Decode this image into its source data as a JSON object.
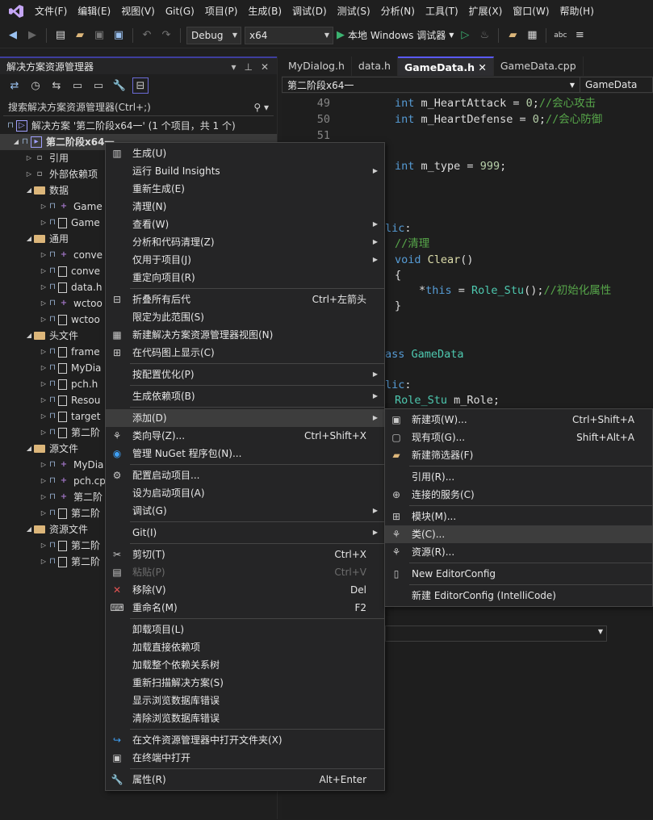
{
  "menubar": {
    "items": [
      "文件(F)",
      "编辑(E)",
      "视图(V)",
      "Git(G)",
      "项目(P)",
      "生成(B)",
      "调试(D)",
      "测试(S)",
      "分析(N)",
      "工具(T)",
      "扩展(X)",
      "窗口(W)",
      "帮助(H)"
    ]
  },
  "toolbar": {
    "config": "Debug",
    "platform": "x64",
    "run_label": "本地 Windows 调试器"
  },
  "solution_explorer": {
    "title": "解决方案资源管理器",
    "search_placeholder": "搜索解决方案资源管理器(Ctrl+;)",
    "solution_label": "解决方案 '第二阶段x64一' (1 个项目，共 1 个)",
    "project_label": "第二阶段x64一",
    "items": [
      {
        "label": "引用",
        "kind": "ref",
        "depth": 1
      },
      {
        "label": "外部依赖项",
        "kind": "ref",
        "depth": 1
      },
      {
        "label": "数据",
        "kind": "folder",
        "depth": 1
      },
      {
        "label": "Game",
        "kind": "cpp",
        "depth": 2
      },
      {
        "label": "Game",
        "kind": "file",
        "depth": 2
      },
      {
        "label": "通用",
        "kind": "folder",
        "depth": 1
      },
      {
        "label": "conve",
        "kind": "cpp",
        "depth": 2
      },
      {
        "label": "conve",
        "kind": "file",
        "depth": 2
      },
      {
        "label": "data.h",
        "kind": "file",
        "depth": 2
      },
      {
        "label": "wctoo",
        "kind": "cpp",
        "depth": 2
      },
      {
        "label": "wctoo",
        "kind": "file",
        "depth": 2
      },
      {
        "label": "头文件",
        "kind": "folder",
        "depth": 1
      },
      {
        "label": "frame",
        "kind": "file",
        "depth": 2
      },
      {
        "label": "MyDia",
        "kind": "file",
        "depth": 2
      },
      {
        "label": "pch.h",
        "kind": "file",
        "depth": 2
      },
      {
        "label": "Resou",
        "kind": "file",
        "depth": 2
      },
      {
        "label": "target",
        "kind": "file",
        "depth": 2
      },
      {
        "label": "第二阶",
        "kind": "file",
        "depth": 2
      },
      {
        "label": "源文件",
        "kind": "folder",
        "depth": 1
      },
      {
        "label": "MyDia",
        "kind": "cpp",
        "depth": 2
      },
      {
        "label": "pch.cp",
        "kind": "cpp",
        "depth": 2
      },
      {
        "label": "第二阶",
        "kind": "cpp",
        "depth": 2
      },
      {
        "label": "第二阶",
        "kind": "file",
        "depth": 2
      },
      {
        "label": "资源文件",
        "kind": "folder",
        "depth": 1
      },
      {
        "label": "第二阶",
        "kind": "file",
        "depth": 2
      },
      {
        "label": "第二阶",
        "kind": "file",
        "depth": 2
      }
    ]
  },
  "editor": {
    "tabs": [
      "MyDialog.h",
      "data.h",
      "GameData.h",
      "GameData.cpp"
    ],
    "active_tab": "GameData.h",
    "nav_scope": "第二阶段x64一",
    "nav_symbol": "GameData",
    "line_numbers": [
      "49",
      "50",
      "51"
    ]
  },
  "context_menu": {
    "items": [
      {
        "label": "生成(U)",
        "icon": "build-icon"
      },
      {
        "label": "运行 Build Insights",
        "submenu": true
      },
      {
        "label": "重新生成(E)"
      },
      {
        "label": "清理(N)"
      },
      {
        "label": "查看(W)",
        "submenu": true
      },
      {
        "label": "分析和代码清理(Z)",
        "submenu": true
      },
      {
        "label": "仅用于项目(J)",
        "submenu": true
      },
      {
        "label": "重定向项目(R)"
      },
      {
        "sep": true
      },
      {
        "label": "折叠所有后代",
        "shortcut": "Ctrl+左箭头",
        "icon": "collapse-icon"
      },
      {
        "label": "限定为此范围(S)"
      },
      {
        "label": "新建解决方案资源管理器视图(N)",
        "icon": "new-view-icon"
      },
      {
        "label": "在代码图上显示(C)",
        "icon": "code-map-icon"
      },
      {
        "sep": true
      },
      {
        "label": "按配置优化(P)",
        "submenu": true
      },
      {
        "sep": true
      },
      {
        "label": "生成依赖项(B)",
        "submenu": true
      },
      {
        "sep": true
      },
      {
        "label": "添加(D)",
        "submenu": true,
        "highlighted": true
      },
      {
        "label": "类向导(Z)...",
        "shortcut": "Ctrl+Shift+X",
        "icon": "class-wizard-icon"
      },
      {
        "label": "管理 NuGet 程序包(N)...",
        "icon": "nuget-icon"
      },
      {
        "sep": true
      },
      {
        "label": "配置启动项目...",
        "icon": "gear-icon"
      },
      {
        "label": "设为启动项目(A)"
      },
      {
        "label": "调试(G)",
        "submenu": true
      },
      {
        "sep": true
      },
      {
        "label": "Git(I)",
        "submenu": true
      },
      {
        "sep": true
      },
      {
        "label": "剪切(T)",
        "shortcut": "Ctrl+X",
        "icon": "cut-icon"
      },
      {
        "label": "粘贴(P)",
        "shortcut": "Ctrl+V",
        "icon": "paste-icon",
        "disabled": true
      },
      {
        "label": "移除(V)",
        "shortcut": "Del",
        "icon": "remove-icon"
      },
      {
        "label": "重命名(M)",
        "shortcut": "F2",
        "icon": "rename-icon"
      },
      {
        "sep": true
      },
      {
        "label": "卸载项目(L)"
      },
      {
        "label": "加载直接依赖项"
      },
      {
        "label": "加载整个依赖关系树"
      },
      {
        "label": "重新扫描解决方案(S)"
      },
      {
        "label": "显示浏览数据库错误"
      },
      {
        "label": "清除浏览数据库错误"
      },
      {
        "sep": true
      },
      {
        "label": "在文件资源管理器中打开文件夹(X)",
        "icon": "open-folder-icon"
      },
      {
        "label": "在终端中打开",
        "icon": "terminal-icon"
      },
      {
        "sep": true
      },
      {
        "label": "属性(R)",
        "shortcut": "Alt+Enter",
        "icon": "wrench-icon"
      }
    ]
  },
  "add_submenu": {
    "items": [
      {
        "label": "新建项(W)...",
        "shortcut": "Ctrl+Shift+A",
        "icon": "new-item-icon"
      },
      {
        "label": "现有项(G)...",
        "shortcut": "Shift+Alt+A",
        "icon": "existing-item-icon"
      },
      {
        "label": "新建筛选器(F)",
        "icon": "new-filter-icon"
      },
      {
        "sep": true
      },
      {
        "label": "引用(R)..."
      },
      {
        "label": "连接的服务(C)",
        "icon": "connected-service-icon"
      },
      {
        "sep": true
      },
      {
        "label": "模块(M)...",
        "icon": "module-icon"
      },
      {
        "label": "类(C)...",
        "icon": "class-icon",
        "highlighted": true
      },
      {
        "label": "资源(R)...",
        "icon": "resource-icon"
      },
      {
        "sep": true
      },
      {
        "label": "New EditorConfig",
        "icon": "editorconfig-icon"
      },
      {
        "sep": true
      },
      {
        "label": "新建 EditorConfig (IntelliCode)"
      }
    ]
  }
}
